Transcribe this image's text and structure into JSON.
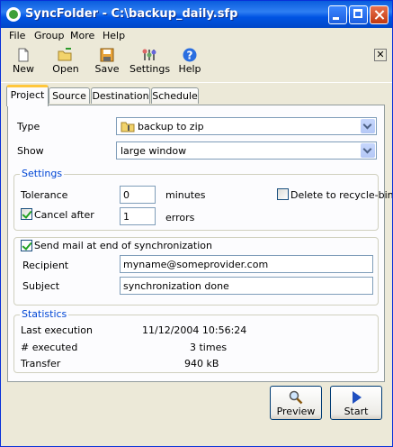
{
  "window": {
    "title": "SyncFolder - C:\\backup_daily.sfp"
  },
  "menu": [
    "File",
    "Group",
    "More",
    "Help"
  ],
  "toolbar": {
    "new": "New",
    "open": "Open",
    "save": "Save",
    "settings": "Settings",
    "help": "Help",
    "close": "✕"
  },
  "tabs": [
    "Project",
    "Source",
    "Destination",
    "Schedule"
  ],
  "project": {
    "type_label": "Type",
    "type_value": "backup to zip",
    "show_label": "Show",
    "show_value": "large window"
  },
  "settings": {
    "title": "Settings",
    "tolerance_label": "Tolerance",
    "tolerance_value": "0",
    "tolerance_unit": "minutes",
    "delete_label": "Delete to recycle-bin",
    "delete_checked": false,
    "cancel_label": "Cancel after",
    "cancel_checked": true,
    "cancel_value": "1",
    "cancel_unit": "errors"
  },
  "mail": {
    "send_label": "Send mail at end of synchronization",
    "send_checked": true,
    "recipient_label": "Recipient",
    "recipient_value": "myname@someprovider.com",
    "subject_label": "Subject",
    "subject_value": "synchronization done"
  },
  "statistics": {
    "title": "Statistics",
    "last_label": "Last execution",
    "last_value": "11/12/2004 10:56:24",
    "executed_label": "# executed",
    "executed_value": "3 times",
    "transfer_label": "Transfer",
    "transfer_value": "940 kB"
  },
  "buttons": {
    "preview": "Preview",
    "start": "Start"
  }
}
